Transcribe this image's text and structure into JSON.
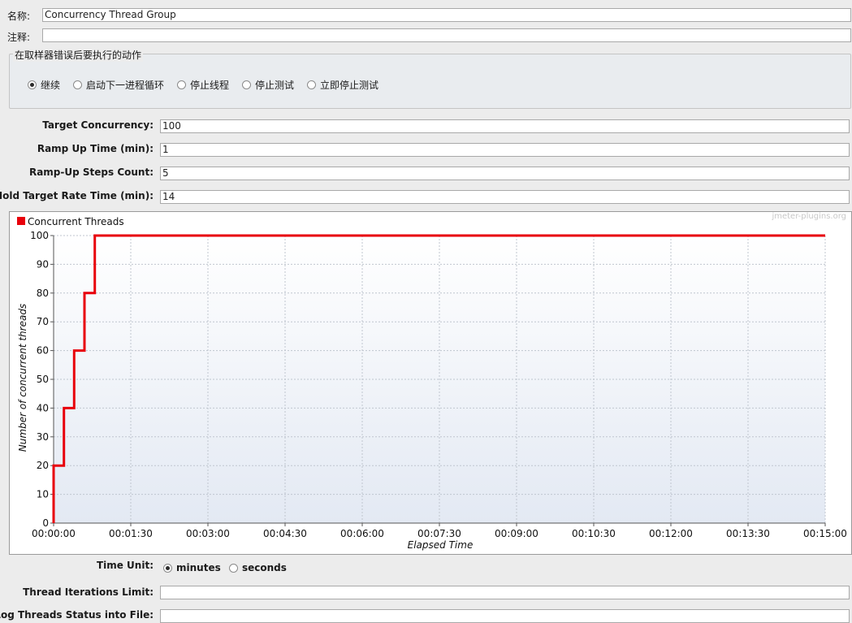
{
  "form": {
    "name_label": "名称:",
    "name_value": "Concurrency Thread Group",
    "comment_label": "注释:",
    "comment_value": ""
  },
  "error_action": {
    "legend": "在取样器错误后要执行的动作",
    "options": [
      {
        "label": "继续",
        "selected": true
      },
      {
        "label": "启动下一进程循环",
        "selected": false
      },
      {
        "label": "停止线程",
        "selected": false
      },
      {
        "label": "停止测试",
        "selected": false
      },
      {
        "label": "立即停止测试",
        "selected": false
      }
    ]
  },
  "fields": {
    "target_concurrency_label": "Target Concurrency:",
    "target_concurrency_value": "100",
    "ramp_up_time_label": "Ramp Up Time (min):",
    "ramp_up_time_value": "1",
    "ramp_up_steps_label": "Ramp-Up Steps Count:",
    "ramp_up_steps_value": "5",
    "hold_time_label": "Hold Target Rate Time (min):",
    "hold_time_value": "14"
  },
  "chart_data": {
    "type": "line",
    "legend": "Concurrent Threads",
    "watermark": "jmeter-plugins.org",
    "xlabel": "Elapsed Time",
    "ylabel": "Number of concurrent threads",
    "series_color": "#e8000b",
    "x_unit": "seconds",
    "xlim": [
      0,
      900
    ],
    "ylim": [
      0,
      100
    ],
    "x_ticks": [
      0,
      90,
      180,
      270,
      360,
      450,
      540,
      630,
      720,
      810,
      900
    ],
    "x_tick_labels": [
      "00:00:00",
      "00:01:30",
      "00:03:00",
      "00:04:30",
      "00:06:00",
      "00:07:30",
      "00:09:00",
      "00:10:30",
      "00:12:00",
      "00:13:30",
      "00:15:00"
    ],
    "y_ticks": [
      0,
      10,
      20,
      30,
      40,
      50,
      60,
      70,
      80,
      90,
      100
    ],
    "grid": true,
    "legend_position": "top-left",
    "series": [
      {
        "name": "Concurrent Threads",
        "x": [
          0,
          0,
          12,
          12,
          24,
          24,
          36,
          36,
          48,
          48,
          60,
          60,
          900
        ],
        "y": [
          0,
          20,
          20,
          40,
          40,
          60,
          60,
          80,
          80,
          100,
          100,
          100,
          100
        ]
      }
    ]
  },
  "time_unit": {
    "label": "Time Unit:",
    "options": [
      {
        "label": "minutes",
        "selected": true
      },
      {
        "label": "seconds",
        "selected": false
      }
    ]
  },
  "iterations": {
    "label": "Thread Iterations Limit:",
    "value": ""
  },
  "log_status": {
    "label": "Log Threads Status into File:",
    "value": ""
  }
}
